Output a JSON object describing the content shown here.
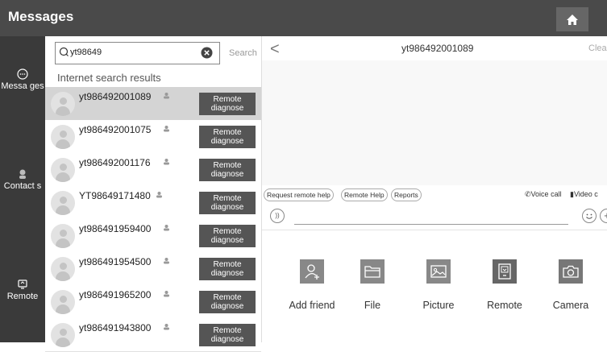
{
  "topbar": {
    "title": "Messages"
  },
  "sidebar": {
    "items": [
      {
        "label": "Messa ges",
        "icon": "chat-bubble-icon"
      },
      {
        "label": "Contact s",
        "icon": "contacts-icon"
      },
      {
        "label": "Remote",
        "icon": "remote-icon"
      }
    ]
  },
  "search": {
    "value": "yt98649",
    "button": "Search"
  },
  "results": {
    "title": "Internet search results",
    "remote_label_1": "Remote",
    "remote_label_2": "diagnose",
    "rows": [
      {
        "name": "yt986492001089"
      },
      {
        "name": "yt986492001075"
      },
      {
        "name": "yt986492001176"
      },
      {
        "name": "YT98649171480"
      },
      {
        "name": "yt986491959400"
      },
      {
        "name": "yt986491954500"
      },
      {
        "name": "yt986491965200"
      },
      {
        "name": "yt986491943800"
      }
    ]
  },
  "chat": {
    "back": "<",
    "title": "yt986492001089",
    "clear": "Clea",
    "chips": [
      "Request remote help",
      "Remote Help",
      "Reports"
    ],
    "voice_call": "Voice call",
    "video_call": "Video c"
  },
  "tools": [
    {
      "label": "Add friend",
      "icon": "add-friend-icon"
    },
    {
      "label": "File",
      "icon": "folder-icon"
    },
    {
      "label": "Picture",
      "icon": "picture-icon"
    },
    {
      "label": "Remote",
      "icon": "remote-device-icon"
    },
    {
      "label": "Camera",
      "icon": "camera-icon"
    }
  ],
  "colors": {
    "topbar": "#4a4a4a",
    "sidebar": "#3a3a3a",
    "button": "#555555",
    "selected_row": "#d4d4d4"
  }
}
